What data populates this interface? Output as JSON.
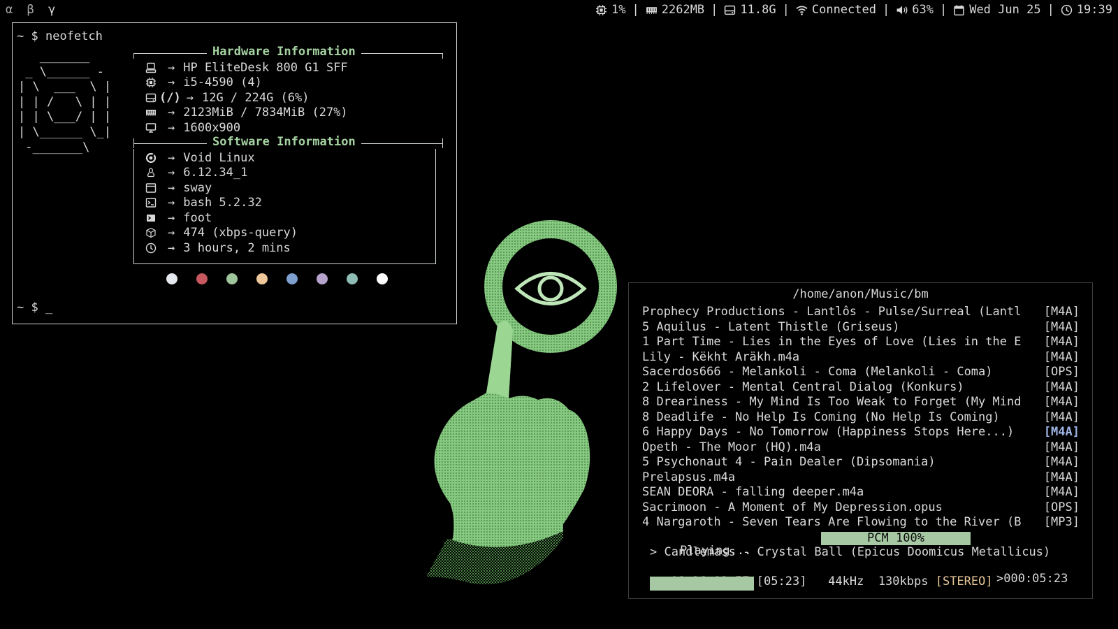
{
  "topbar": {
    "workspaces": [
      "α",
      "β",
      "γ"
    ],
    "cpu": "1%",
    "memory": "2262MB",
    "disk": "11.8G",
    "network": "Connected",
    "volume": "63%",
    "date": "Wed Jun 25",
    "time": "19:39",
    "separator": "|"
  },
  "terminal": {
    "prompt": "~ $",
    "command": "neofetch",
    "cursor": "_",
    "ascii_logo": "   _______\n _ \\______ -\n| \\  ___  \\ |\n| | /   \\ | |\n| | \\___/ | |\n| \\______ \\_|\n -_______\\",
    "hardware_title": "Hardware Information",
    "software_title": "Software Information",
    "arrow": "→",
    "disk_label": "(/)",
    "hardware": [
      {
        "icon": "computer-icon",
        "value": "HP EliteDesk 800 G1 SFF"
      },
      {
        "icon": "cpu-icon",
        "value": "i5-4590 (4)"
      },
      {
        "icon": "disk-icon",
        "value": "12G / 224G (6%)"
      },
      {
        "icon": "memory-icon",
        "value": "2123MiB / 7834MiB (27%)"
      },
      {
        "icon": "monitor-icon",
        "value": "1600x900"
      }
    ],
    "software": [
      {
        "icon": "void-linux-icon",
        "value": "Void Linux"
      },
      {
        "icon": "linux-kernel-icon",
        "value": "6.12.34_1"
      },
      {
        "icon": "window-manager-icon",
        "value": "sway"
      },
      {
        "icon": "shell-icon",
        "value": "bash 5.2.32"
      },
      {
        "icon": "terminal-icon",
        "value": "foot"
      },
      {
        "icon": "package-icon",
        "value": "474 (xbps-query)"
      },
      {
        "icon": "clock-icon",
        "value": "3 hours, 2 mins"
      }
    ],
    "palette": [
      "#e5e8ee",
      "#c8585f",
      "#9fc59a",
      "#eec89a",
      "#7f9fcf",
      "#b5a3cc",
      "#8fbcb5",
      "#ffffff"
    ]
  },
  "player": {
    "path": "/home/anon/Music/bm",
    "tracks": [
      {
        "name": "Prophecy Productions - Lantlôs - Pulse/Surreal (Lantl",
        "format": "[M4A]"
      },
      {
        "name": "5 Aquilus - Latent Thistle (Griseus)",
        "format": "[M4A]"
      },
      {
        "name": "1 Part Time - Lies in the Eyes of Love (Lies in the E",
        "format": "[M4A]"
      },
      {
        "name": "Lily - Këkht Aräkh.m4a",
        "format": "[M4A]"
      },
      {
        "name": "Sacerdos666 - Melankoli - Coma (Melankoli - Coma)",
        "format": "[OPS]"
      },
      {
        "name": "2 Lifelover - Mental Central Dialog (Konkurs)",
        "format": "[M4A]"
      },
      {
        "name": "8 Dreariness - My Mind Is Too Weak to Forget (My Mind",
        "format": "[M4A]"
      },
      {
        "name": "8 Deadlife - No Help Is Coming (No Help Is Coming)",
        "format": "[M4A]"
      },
      {
        "name": "6 Happy Days - No Tomorrow (Happiness Stops Here...)",
        "format": "[M4A]"
      },
      {
        "name": "Opeth - The Moor (HQ).m4a",
        "format": "[M4A]"
      },
      {
        "name": "5 Psychonaut 4 - Pain Dealer (Dipsomania)",
        "format": "[M4A]"
      },
      {
        "name": "Prelapsus.m4a",
        "format": "[M4A]"
      },
      {
        "name": "SEAN DEORA - falling deeper.m4a",
        "format": "[M4A]"
      },
      {
        "name": "Sacrimoon - A Moment of My Depression.opus",
        "format": "[OPS]"
      },
      {
        "name": "4 Nargaroth - Seven Tears Are Flowing to the River (B",
        "format": "[MP3]"
      }
    ],
    "selected_index": 8,
    "status": "Playing...",
    "pcm": "PCM 100%",
    "elapsed_display": ">000:05:23",
    "now_playing": "> Candlemass - Crystal Ball (Epicus Doomicus Metallicus)",
    "time_info": "01:26 03:57 [05:23]",
    "sample_rate": "44kHz",
    "bitrate": "130kbps",
    "channels": "[STEREO]",
    "progress_fraction": 0.24
  },
  "colors": {
    "accent": "#a6d3a2",
    "text": "#d9d9d9",
    "selected_format": "#9fb6e8",
    "channels": "#e8c79a",
    "bar": "#a6c9a3"
  }
}
